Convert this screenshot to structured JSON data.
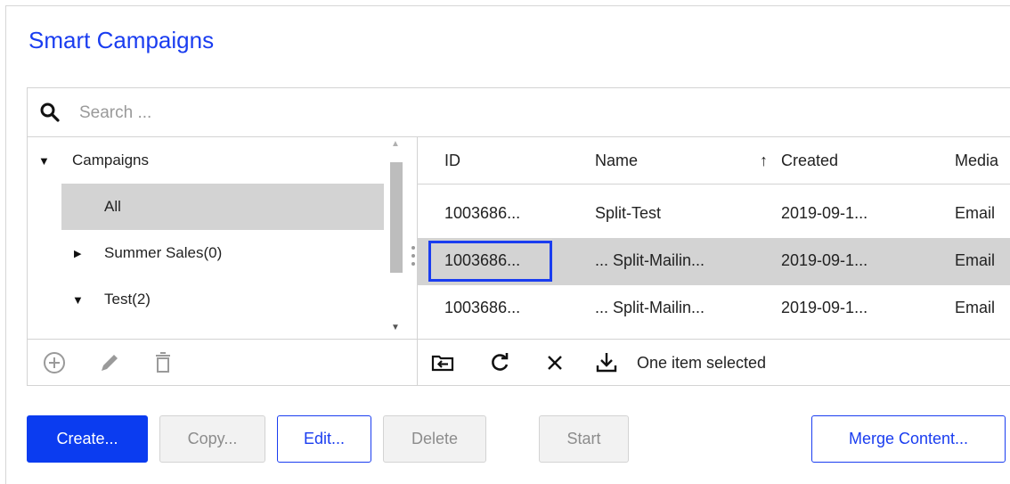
{
  "title": "Smart Campaigns",
  "search": {
    "placeholder": "Search ..."
  },
  "tree": {
    "root": "Campaigns",
    "items": [
      {
        "label": "All"
      },
      {
        "label": "Summer Sales(0)"
      },
      {
        "label": "Test(2)"
      }
    ]
  },
  "table": {
    "columns": [
      "ID",
      "Name",
      "Created",
      "Media"
    ],
    "sort_indicator": "↑",
    "rows": [
      {
        "id": "1003686...",
        "name": "Split-Test",
        "created": "2019-09-1...",
        "media": "Email"
      },
      {
        "id": "1003686...",
        "name": "... Split-Mailin...",
        "created": "2019-09-1...",
        "media": "Email"
      },
      {
        "id": "1003686...",
        "name": "... Split-Mailin...",
        "created": "2019-09-1...",
        "media": "Email"
      }
    ],
    "status": "One item selected"
  },
  "buttons": {
    "create": "Create...",
    "copy": "Copy...",
    "edit": "Edit...",
    "delete": "Delete",
    "start": "Start",
    "merge": "Merge Content..."
  },
  "colors": {
    "accent": "#1a3df0",
    "primary_button": "#0b3cf0",
    "selection": "#d3d3d3"
  }
}
